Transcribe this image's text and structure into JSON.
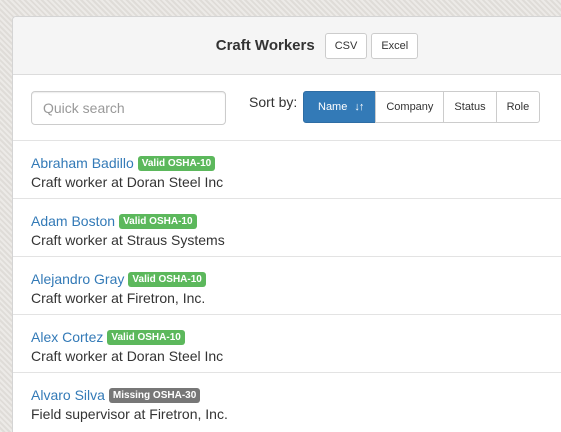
{
  "header": {
    "title": "Craft Workers",
    "csv_label": "CSV",
    "excel_label": "Excel"
  },
  "search": {
    "placeholder": "Quick search",
    "value": ""
  },
  "sort": {
    "label": "Sort by:",
    "options": [
      "Name",
      "Company",
      "Status",
      "Role"
    ],
    "active": "Name",
    "active_icon": "sort-alpha-icon"
  },
  "colors": {
    "primary": "#337ab7",
    "valid_badge": "#5cb85c",
    "missing_badge": "#777777"
  },
  "workers": [
    {
      "name": "Abraham Badillo",
      "badge": "Valid OSHA-10",
      "status": "valid",
      "description": "Craft worker at Doran Steel Inc"
    },
    {
      "name": "Adam Boston",
      "badge": "Valid OSHA-10",
      "status": "valid",
      "description": "Craft worker at Straus Systems"
    },
    {
      "name": "Alejandro Gray",
      "badge": "Valid OSHA-10",
      "status": "valid",
      "description": "Craft worker at Firetron, Inc."
    },
    {
      "name": "Alex Cortez",
      "badge": "Valid OSHA-10",
      "status": "valid",
      "description": "Craft worker at Doran Steel Inc"
    },
    {
      "name": "Alvaro Silva",
      "badge": "Missing OSHA-30",
      "status": "missing",
      "description": "Field supervisor at Firetron, Inc."
    }
  ]
}
